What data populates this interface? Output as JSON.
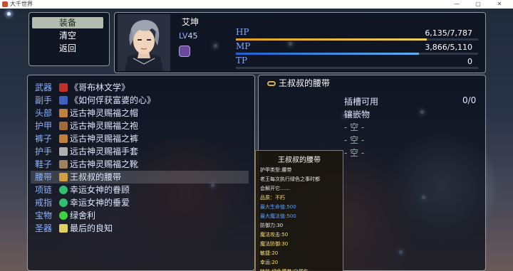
{
  "window": {
    "title": "大千世界",
    "minimize_glyph": "—",
    "maximize_glyph": "▢",
    "close_glyph": "✕"
  },
  "command_menu": {
    "items": [
      {
        "label": "装备",
        "selected": true
      },
      {
        "label": "清空",
        "selected": false
      },
      {
        "label": "返回",
        "selected": false
      }
    ]
  },
  "actor": {
    "name": "艾坤",
    "level_label": "LV",
    "level": "45",
    "state_icon": "purple-grin-icon",
    "gauges": [
      {
        "label": "HP",
        "value": "6,135/7,787",
        "fill": 0.788,
        "color_start": "#e0a020",
        "color_end": "#f0d060"
      },
      {
        "label": "MP",
        "value": "3,866/5,110",
        "fill": 0.757,
        "color_start": "#2060d0",
        "color_end": "#60b0f0"
      },
      {
        "label": "TP",
        "value": "0",
        "fill": 0,
        "color_start": "#30a040",
        "color_end": "#70d070"
      }
    ]
  },
  "equip_slots": [
    {
      "slot": "武器",
      "item": "《哥布林文学》",
      "icon": "red-book-icon",
      "icon_color": "#c0302a"
    },
    {
      "slot": "副手",
      "item": "《如何俘获富婆的心》",
      "icon": "blue-book-icon",
      "icon_color": "#4060c0"
    },
    {
      "slot": "头部",
      "item": "远古神灵赐福之帽",
      "icon": "hat-icon",
      "icon_color": "#c08040"
    },
    {
      "slot": "护甲",
      "item": "远古神灵赐福之袍",
      "icon": "robe-icon",
      "icon_color": "#a06a3a"
    },
    {
      "slot": "裤子",
      "item": "远古神灵赐福之裤",
      "icon": "pants-icon",
      "icon_color": "#c0803a"
    },
    {
      "slot": "护手",
      "item": "远古神灵赐福手套",
      "icon": "gloves-icon",
      "icon_color": "#b0b0b0"
    },
    {
      "slot": "鞋子",
      "item": "远古神灵赐福之靴",
      "icon": "boots-icon",
      "icon_color": "#a08060"
    },
    {
      "slot": "腰带",
      "item": "王叔叔的腰带",
      "icon": "belt-icon",
      "icon_color": "#d0a040",
      "selected": true
    },
    {
      "slot": "项链",
      "item": "幸运女神的眷顾",
      "icon": "green-gem-icon",
      "icon_color": "#30c070"
    },
    {
      "slot": "戒指",
      "item": "幸运女神的垂爱",
      "icon": "green-gem-icon",
      "icon_color": "#30c070"
    },
    {
      "slot": "宝物",
      "item": "绿舍利",
      "icon": "green-orb-icon",
      "icon_color": "#40d040"
    },
    {
      "slot": "圣器",
      "item": "最后的良知",
      "icon": "relic-icon",
      "icon_color": "#e0d060"
    }
  ],
  "item_panel": {
    "title": "王叔叔的腰带",
    "socket_label": "插槽可用",
    "socket_value": "0/0",
    "inlay_label": "镶嵌物",
    "empty_slots": [
      "- 空 -",
      "- 空 -",
      "- 空 -"
    ]
  },
  "item_detail": {
    "title": "王叔叔的腰带",
    "lines": [
      {
        "text": "护甲类型:腰带",
        "color": "#e8e8e8"
      },
      {
        "text": "老王每次执行绿色之事时都",
        "color": "#e8e8e8"
      },
      {
        "text": "会解开它……",
        "color": "#e8e8e8"
      },
      {
        "text": "品质：不朽",
        "color": "#ffe070"
      },
      {
        "text": "最大生命值:500",
        "color": "#60a0ff"
      },
      {
        "text": "最大魔法值:500",
        "color": "#60a0ff"
      },
      {
        "text": "防御力:30",
        "color": "#e8e8e8"
      },
      {
        "text": "魔法攻击:50",
        "color": "#ffe070"
      },
      {
        "text": "魔法防御:30",
        "color": "#ffe070"
      },
      {
        "text": "敏捷:20",
        "color": "#ffe070"
      },
      {
        "text": "幸运:20",
        "color": "#ffe070"
      },
      {
        "text": "特效:绿色腰带/自然伤",
        "color": "#ffe070"
      }
    ]
  }
}
